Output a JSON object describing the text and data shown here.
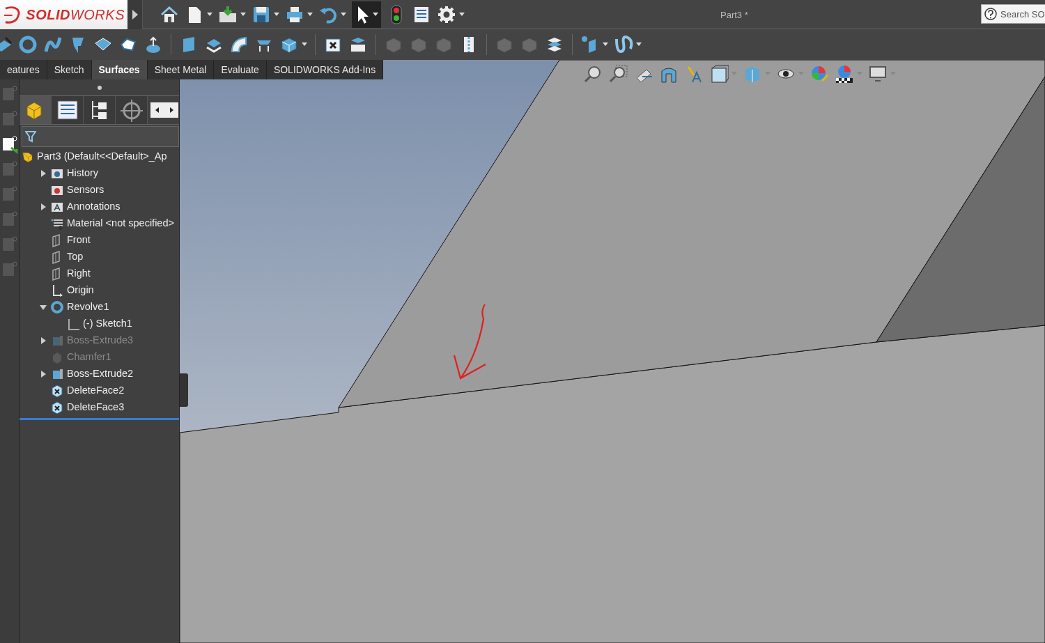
{
  "title_bar": {
    "logo_text": "**SOLID**WORKS",
    "document_title": "Part3 *",
    "search": {
      "placeholder": "Search SO"
    }
  },
  "command_tabs": [
    {
      "label": "eatures",
      "selected": false
    },
    {
      "label": "Sketch",
      "selected": false
    },
    {
      "label": "Surfaces",
      "selected": true
    },
    {
      "label": "Sheet Metal",
      "selected": false
    },
    {
      "label": "Evaluate",
      "selected": false
    },
    {
      "label": "SOLIDWORKS Add-Ins",
      "selected": false
    }
  ],
  "panel_tabs": [
    {
      "kind": "feature",
      "selected": true
    },
    {
      "kind": "property",
      "selected": false
    },
    {
      "kind": "config",
      "selected": false
    },
    {
      "kind": "dim",
      "selected": false
    }
  ],
  "tree": {
    "root": "Part3  (Default<<Default>_Ap",
    "items": [
      {
        "label": "History",
        "kind": "history",
        "expanded": false,
        "suppressed": false
      },
      {
        "label": "Sensors",
        "kind": "sensors",
        "suppressed": false
      },
      {
        "label": "Annotations",
        "kind": "annotations",
        "expanded": false,
        "suppressed": false
      },
      {
        "label": "Material <not specified>",
        "kind": "material",
        "suppressed": false
      },
      {
        "label": "Front",
        "kind": "plane",
        "suppressed": false
      },
      {
        "label": "Top",
        "kind": "plane",
        "suppressed": false
      },
      {
        "label": "Right",
        "kind": "plane",
        "suppressed": false
      },
      {
        "label": "Origin",
        "kind": "origin",
        "suppressed": false
      },
      {
        "label": "Revolve1",
        "kind": "revolve",
        "expanded": true,
        "suppressed": false,
        "children": [
          {
            "label": "(-) Sketch1",
            "kind": "sketch",
            "suppressed": false
          }
        ]
      },
      {
        "label": "Boss-Extrude3",
        "kind": "extrude",
        "expanded": false,
        "suppressed": true
      },
      {
        "label": "Chamfer1",
        "kind": "chamfer",
        "suppressed": true
      },
      {
        "label": "Boss-Extrude2",
        "kind": "extrude",
        "expanded": false,
        "suppressed": false
      },
      {
        "label": "DeleteFace2",
        "kind": "deleteface",
        "suppressed": false
      },
      {
        "label": "DeleteFace3",
        "kind": "deleteface",
        "suppressed": false
      }
    ]
  }
}
